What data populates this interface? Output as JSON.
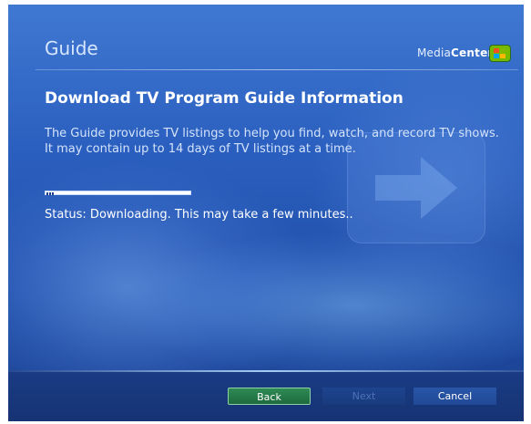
{
  "header": {
    "title": "Guide",
    "brand_light": "Media",
    "brand_bold": "Center"
  },
  "main": {
    "title": "Download TV Program Guide Information",
    "description": "The Guide provides TV listings to help you find, watch, and record TV shows. It may contain up to 14 days of TV listings at a time.",
    "progress_fraction": 0.06,
    "status": "Status: Downloading. This may take a few minutes.."
  },
  "footer": {
    "back_label": "Back",
    "next_label": "Next",
    "cancel_label": "Cancel"
  },
  "colors": {
    "background": "#2b5fbf",
    "back_button": "#1d6a3e",
    "cancel_button": "#214a96"
  },
  "icons": [
    "arrow-watermark-icon",
    "windows-flag-icon"
  ]
}
